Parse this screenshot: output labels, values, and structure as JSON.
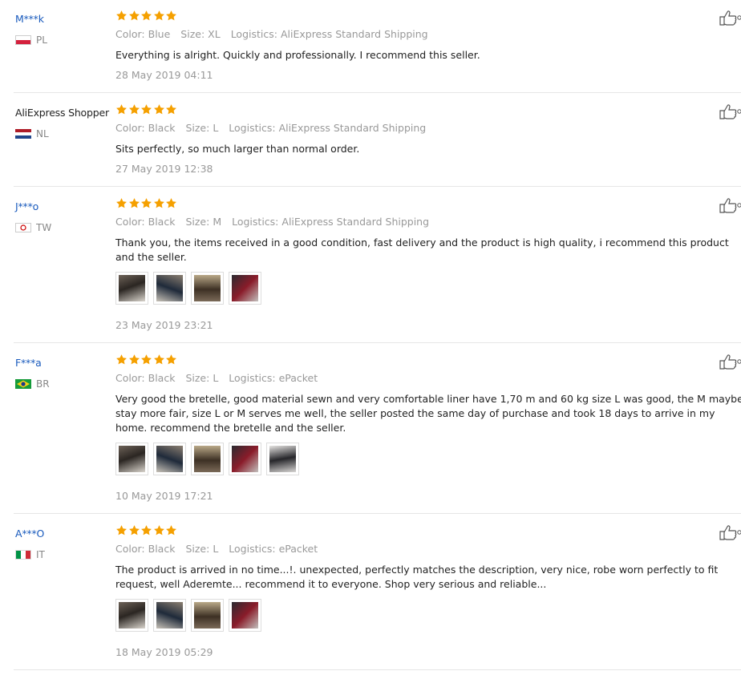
{
  "labels": {
    "color": "Color:",
    "size": "Size:",
    "logistics": "Logistics:"
  },
  "colors": {
    "star": "#f5a000",
    "username_link": "#1a5bbd",
    "muted": "#999999"
  },
  "reviews": [
    {
      "user": "M***k",
      "country": "PL",
      "rating": 5,
      "color": "Blue",
      "size": "XL",
      "logistics": "AliExpress Standard Shipping",
      "text": "Everything is alright. Quickly and professionally. I recommend this seller.",
      "date": "28 May 2019 04:11",
      "photos": []
    },
    {
      "user": "AliExpress Shopper",
      "country": "NL",
      "rating": 5,
      "color": "Black",
      "size": "L",
      "logistics": "AliExpress Standard Shipping",
      "text": "Sits perfectly, so much larger than normal order.",
      "date": "27 May 2019 12:38",
      "photos": []
    },
    {
      "user": "J***o",
      "country": "TW",
      "rating": 5,
      "color": "Black",
      "size": "M",
      "logistics": "AliExpress Standard Shipping",
      "text": "Thank you, the items received in a good condition, fast delivery and the product is high quality, i recommend this product and the seller.",
      "date": "23 May 2019 23:21",
      "photos": [
        "review-photo-1",
        "review-photo-2",
        "review-photo-3",
        "review-photo-4"
      ]
    },
    {
      "user": "F***a",
      "country": "BR",
      "rating": 5,
      "color": "Black",
      "size": "L",
      "logistics": "ePacket",
      "text": "Very good the bretelle, good material sewn and very comfortable liner have 1,70 m and 60 kg size L was good, the M maybe stay more fair, size L or M serves me well, the seller posted the same day of purchase and took 18 days to arrive in my home. recommend the bretelle and the seller.",
      "date": "10 May 2019 17:21",
      "photos": [
        "review-photo-1",
        "review-photo-2",
        "review-photo-3",
        "review-photo-4",
        "review-photo-5"
      ]
    },
    {
      "user": "A***O",
      "country": "IT",
      "rating": 5,
      "color": "Black",
      "size": "L",
      "logistics": "ePacket",
      "text": "The product is arrived in no time...!. unexpected, perfectly matches the description, very nice, robe worn perfectly to fit request, well Aderemte... recommend it to everyone. Shop very serious and reliable...",
      "date": "18 May 2019 05:29",
      "photos": [
        "review-photo-1",
        "review-photo-2",
        "review-photo-3",
        "review-photo-4"
      ]
    }
  ]
}
